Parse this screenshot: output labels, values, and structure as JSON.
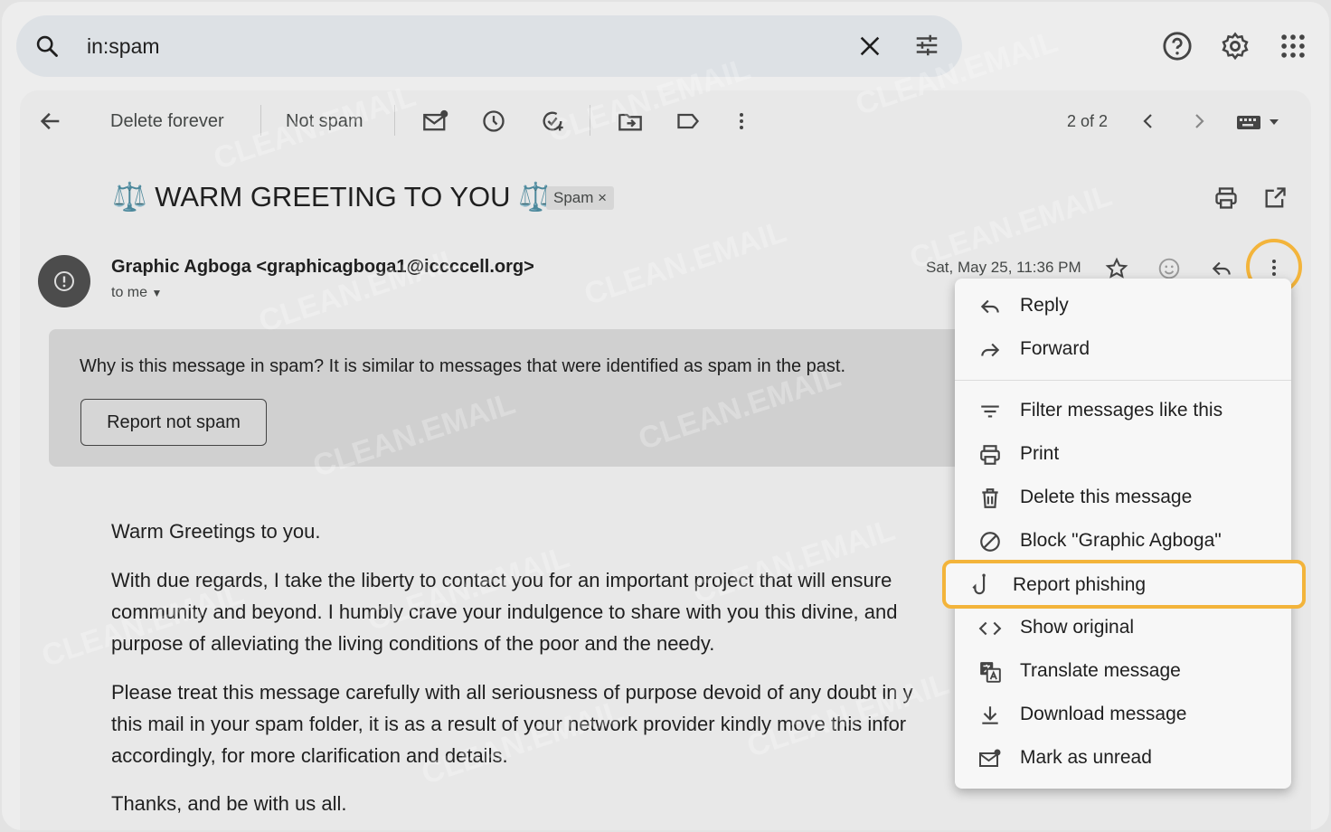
{
  "search": {
    "query": "in:spam"
  },
  "toolbar": {
    "delete_forever": "Delete forever",
    "not_spam": "Not spam",
    "pagination": "2 of 2"
  },
  "message": {
    "subject": "⚖️ WARM GREETING TO YOU ⚖️",
    "label": "Spam",
    "sender": "Graphic Agboga <graphicagboga1@iccccell.org>",
    "recipient": "to me",
    "date": "Sat, May 25, 11:36 PM"
  },
  "spam_notice": {
    "question": "Why is this message in spam?",
    "reason": " It is similar to messages that were identified as spam in the past.",
    "button": "Report not spam"
  },
  "body": {
    "p1": "Warm Greetings to you.",
    "p2a": "With due regards, I take the liberty to contact you for an important project that will ensure",
    "p2b": "community and beyond. I humbly crave your indulgence to share with you this divine, and",
    "p2c": "purpose of alleviating the living conditions of the poor and the needy.",
    "p3a": "Please treat this message carefully with all seriousness of purpose devoid of any doubt in y",
    "p3b": "this mail in your spam folder, it is as a result of your network provider kindly move this infor",
    "p3c": "accordingly, for more clarification and details.",
    "p4": "Thanks, and be with us all."
  },
  "menu": {
    "items": [
      {
        "label": "Reply",
        "icon": "reply-icon"
      },
      {
        "label": "Forward",
        "icon": "forward-icon"
      },
      {
        "label": "Filter messages like this",
        "icon": "filter-icon"
      },
      {
        "label": "Print",
        "icon": "print-icon"
      },
      {
        "label": "Delete this message",
        "icon": "trash-icon"
      },
      {
        "label": "Block \"Graphic Agboga\"",
        "icon": "block-icon"
      },
      {
        "label": "Report phishing",
        "icon": "phishing-hook-icon"
      },
      {
        "label": "Show original",
        "icon": "code-icon"
      },
      {
        "label": "Translate message",
        "icon": "translate-icon"
      },
      {
        "label": "Download message",
        "icon": "download-icon"
      },
      {
        "label": "Mark as unread",
        "icon": "mark-unread-icon"
      }
    ]
  },
  "colors": {
    "highlight": "#f3b43b",
    "avatar": "#4c4c4c"
  },
  "watermark": "CLEAN.EMAIL"
}
